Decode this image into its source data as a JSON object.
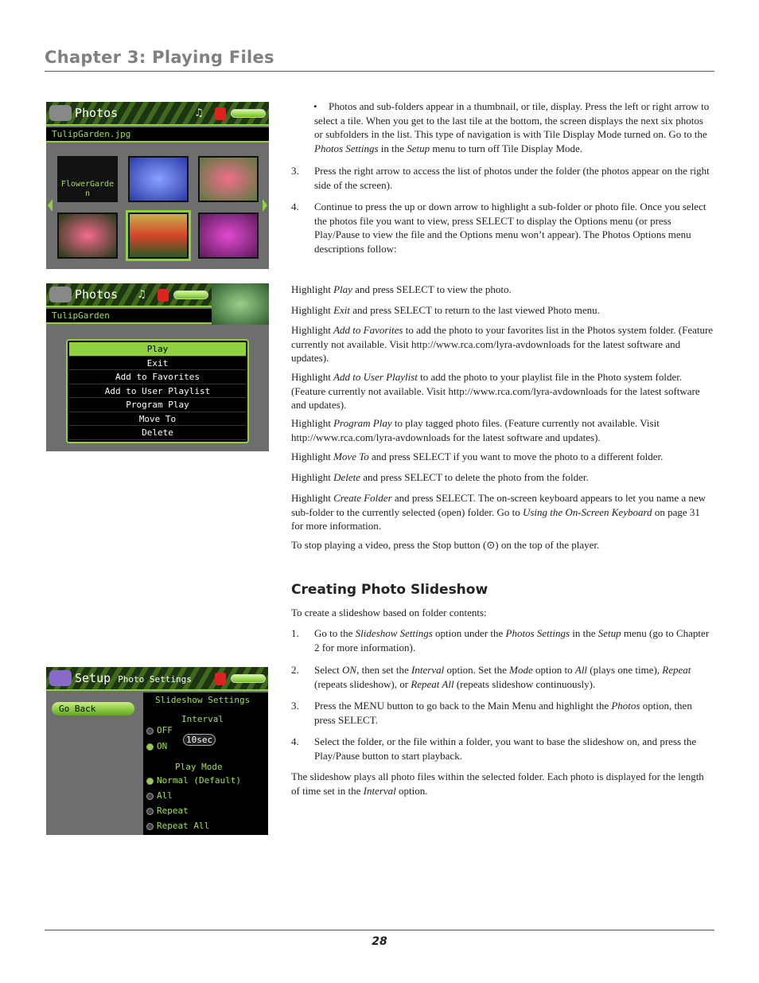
{
  "header": {
    "chapter_title": "Chapter 3: Playing Files"
  },
  "screen1": {
    "title": "Photos",
    "filename": "TulipGarden.jpg",
    "folder_label": "FlowerGarden"
  },
  "screen2": {
    "title": "Photos",
    "filename": "TulipGarden",
    "menu": [
      "Play",
      "Exit",
      "Add to Favorites",
      "Add to User Playlist",
      "Program Play",
      "Move To",
      "Delete"
    ]
  },
  "screen3": {
    "title": "Setup",
    "subtitle": "Photo Settings",
    "go_back": "Go Back",
    "section": "Slideshow Settings",
    "interval_label": "Interval",
    "off": "OFF",
    "on": "ON",
    "interval_value": "10sec",
    "play_mode_label": "Play Mode",
    "modes": [
      "Normal (Default)",
      "All",
      "Repeat",
      "Repeat All"
    ]
  },
  "body": {
    "bullet": [
      {
        "t": "Photos and sub-folders appear in a thumbnail, or tile, display. Press the left or right arrow to select a tile. When you get to the last tile at the bottom, the screen displays the next six photos or subfolders in the list. This type of navigation is with Tile Display Mode turned on. Go to the "
      },
      {
        "t": "Photos Settings",
        "i": 1
      },
      {
        "t": " in the "
      },
      {
        "t": "Setup",
        "i": 1
      },
      {
        "t": " menu to turn off Tile Display Mode."
      }
    ],
    "steps": [
      {
        "n": "3.",
        "s": [
          {
            "t": "Press the right arrow to access the list of photos under the folder (the photos appear on the right side of the screen)."
          }
        ]
      },
      {
        "n": "4.",
        "s": [
          {
            "t": "Continue to press the up or down arrow to highlight a sub-folder or photo file. Once you select the photos file you want to view, press SELECT to display the Options menu (or press Play/Pause to view the file and the Options menu won’t appear). The Photos Options menu descriptions follow:"
          }
        ]
      }
    ],
    "paras": [
      [
        {
          "t": "Highlight "
        },
        {
          "t": "Play",
          "i": 1
        },
        {
          "t": " and press SELECT to view the photo."
        }
      ],
      [
        {
          "t": "Highlight "
        },
        {
          "t": "Exit",
          "i": 1
        },
        {
          "t": " and press SELECT to return to the last viewed Photo menu."
        }
      ],
      [
        {
          "t": "Highlight "
        },
        {
          "t": "Add to Favorites",
          "i": 1
        },
        {
          "t": " to add the photo to your favorites list in the Photos system folder. (Feature currently not available. Visit http://www.rca.com/lyra-avdownloads for the latest software and updates)."
        }
      ],
      [
        {
          "t": "Highlight "
        },
        {
          "t": "Add to User Playlist",
          "i": 1
        },
        {
          "t": " to add the photo to your playlist file in the Photo system folder. (Feature currently not available. Visit http://www.rca.com/lyra-avdownloads for the latest software and updates)."
        }
      ],
      [
        {
          "t": "Highlight "
        },
        {
          "t": "Program Play",
          "i": 1
        },
        {
          "t": " to play tagged photo files. (Feature currently not available. Visit http://www.rca.com/lyra-avdownloads for the latest software and updates)."
        }
      ],
      [
        {
          "t": "Highlight "
        },
        {
          "t": "Move To",
          "i": 1
        },
        {
          "t": " and press SELECT if you want to move the photo to a different folder."
        }
      ],
      [
        {
          "t": "Highlight "
        },
        {
          "t": "Delete",
          "i": 1
        },
        {
          "t": " and press SELECT to delete the photo from the folder."
        }
      ],
      [
        {
          "t": "Highlight "
        },
        {
          "t": "Create Folder",
          "i": 1
        },
        {
          "t": " and press SELECT. The on-screen keyboard appears to let you name a new sub-folder to the currently selected (open) folder. Go to "
        },
        {
          "t": "Using the On-Screen Keyboard",
          "i": 1
        },
        {
          "t": " on page 31 for more information."
        }
      ],
      [
        {
          "t": "To stop playing a video, press the Stop button (⊙) on the top of the player."
        }
      ]
    ],
    "slideshow_heading": "Creating Photo Slideshow",
    "slideshow_intro": [
      {
        "t": "To create a slideshow based on folder contents:"
      }
    ],
    "slideshow_steps": [
      {
        "n": "1.",
        "s": [
          {
            "t": "Go to the "
          },
          {
            "t": "Slideshow Settings",
            "i": 1
          },
          {
            "t": " option under the "
          },
          {
            "t": "Photos Settings",
            "i": 1
          },
          {
            "t": " in the "
          },
          {
            "t": "Setup",
            "i": 1
          },
          {
            "t": " menu (go to Chapter 2 for more information)."
          }
        ]
      },
      {
        "n": "2.",
        "s": [
          {
            "t": "Select "
          },
          {
            "t": "ON",
            "i": 1
          },
          {
            "t": ", then set the "
          },
          {
            "t": "Interval",
            "i": 1
          },
          {
            "t": " option. Set the "
          },
          {
            "t": "Mode",
            "i": 1
          },
          {
            "t": " option to "
          },
          {
            "t": "All",
            "i": 1
          },
          {
            "t": " (plays one time), "
          },
          {
            "t": "Repeat",
            "i": 1
          },
          {
            "t": " (repeats slideshow), or "
          },
          {
            "t": "Repeat All",
            "i": 1
          },
          {
            "t": " (repeats slideshow continuously)."
          }
        ]
      },
      {
        "n": "3.",
        "s": [
          {
            "t": "Press the MENU button to go back to the Main Menu and highlight the "
          },
          {
            "t": "Photos",
            "i": 1
          },
          {
            "t": " option, then press SELECT."
          }
        ]
      },
      {
        "n": "4.",
        "s": [
          {
            "t": "Select the folder, or the file within a folder, you want to base the slideshow on, and press the Play/Pause button to start playback."
          }
        ]
      }
    ],
    "closing": [
      {
        "t": "The slideshow plays all photo files within the selected folder. Each photo is displayed for the length of time set in the "
      },
      {
        "t": "Interval",
        "i": 1
      },
      {
        "t": " option."
      }
    ]
  },
  "footer": {
    "page_number": "28"
  }
}
